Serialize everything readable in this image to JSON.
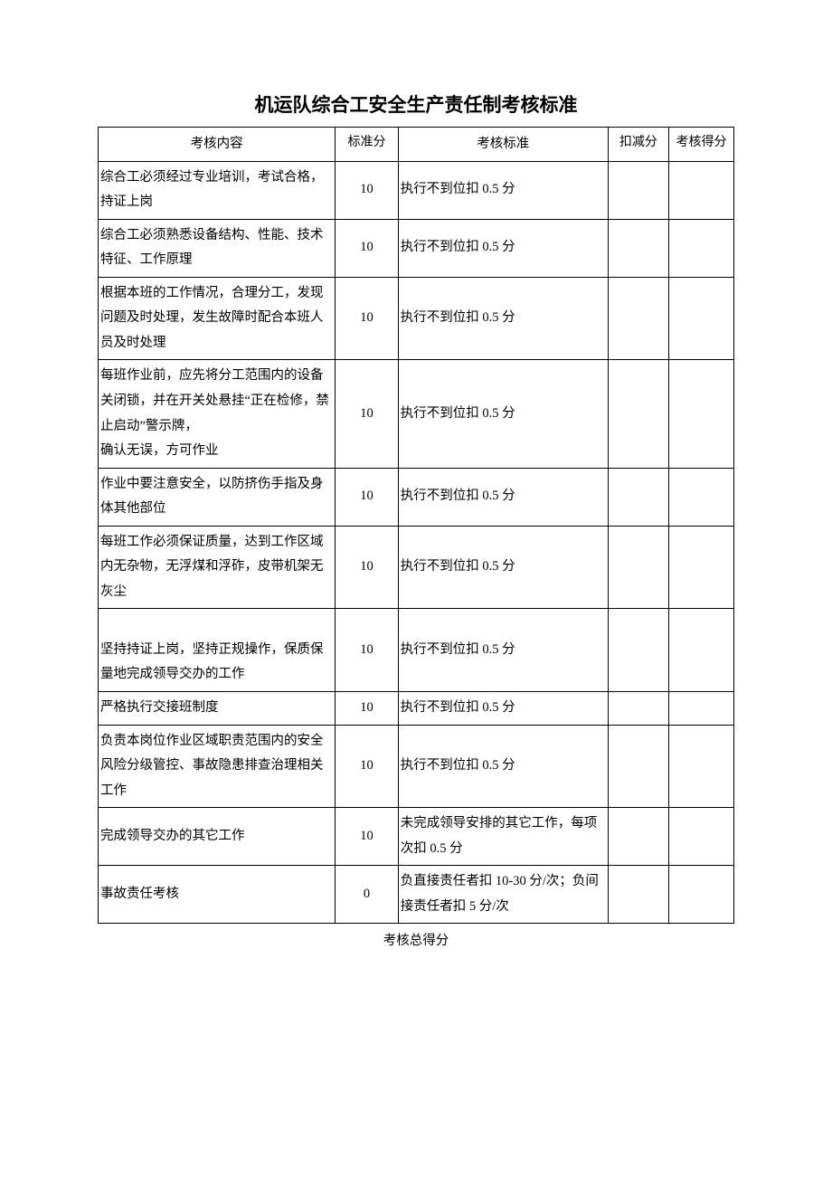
{
  "title": "机运队综合工安全生产责任制考核标准",
  "headers": {
    "content": "考核内容",
    "standard_score": "标准分",
    "standard": "考核标准",
    "deduct": "扣减分",
    "final": "考核得分"
  },
  "rows": [
    {
      "content": "综合工必须经过专业培训，考试合格，持证上岗",
      "standard_score": "10",
      "standard": "执行不到位扣 0.5 分",
      "deduct": "",
      "final": ""
    },
    {
      "content": "综合工必须熟悉设备结构、性能、技术特征、工作原理",
      "standard_score": "10",
      "standard": "执行不到位扣 0.5 分",
      "deduct": "",
      "final": ""
    },
    {
      "content": "根据本班的工作情况，合理分工，发现问题及时处理，发生故障时配合本班人员及时处理",
      "standard_score": "10",
      "standard": "执行不到位扣 0.5 分",
      "deduct": "",
      "final": ""
    },
    {
      "content": "每班作业前，应先将分工范围内的设备关闭锁，并在开关处悬挂“正在检修，禁止启动”警示牌，\n确认无误，方可作业",
      "standard_score": "10",
      "standard": "执行不到位扣 0.5 分",
      "deduct": "",
      "final": ""
    },
    {
      "content": "作业中要注意安全，以防挤伤手指及身体其他部位",
      "standard_score": "10",
      "standard": "执行不到位扣 0.5 分",
      "deduct": "",
      "final": ""
    },
    {
      "content": "每班工作必须保证质量，达到工作区域内无杂物，无浮煤和浮砟，皮带机架无灰尘",
      "standard_score": "10",
      "standard": "执行不到位扣 0.5 分",
      "deduct": "",
      "final": ""
    },
    {
      "content": "\n坚持持证上岗，坚持正规操作，保质保量地完成领导交办的工作",
      "standard_score": "10",
      "standard": "执行不到位扣 0.5 分",
      "deduct": "",
      "final": ""
    },
    {
      "content": "严格执行交接班制度",
      "standard_score": "10",
      "standard": "执行不到位扣 0.5 分",
      "deduct": "",
      "final": ""
    },
    {
      "content": "负责本岗位作业区域职责范围内的安全风险分级管控、事故隐患排查治理相关工作",
      "standard_score": "10",
      "standard": "执行不到位扣 0.5 分",
      "deduct": "",
      "final": ""
    },
    {
      "content": "完成领导交办的其它工作",
      "standard_score": "10",
      "standard": "未完成领导安排的其它工作，每项次扣 0.5 分",
      "deduct": "",
      "final": ""
    },
    {
      "content": "事故责任考核",
      "standard_score": "0",
      "standard": "负直接责任者扣 10-30 分/次；负间接责任者扣 5 分/次",
      "deduct": "",
      "final": ""
    }
  ],
  "footer": "考核总得分"
}
